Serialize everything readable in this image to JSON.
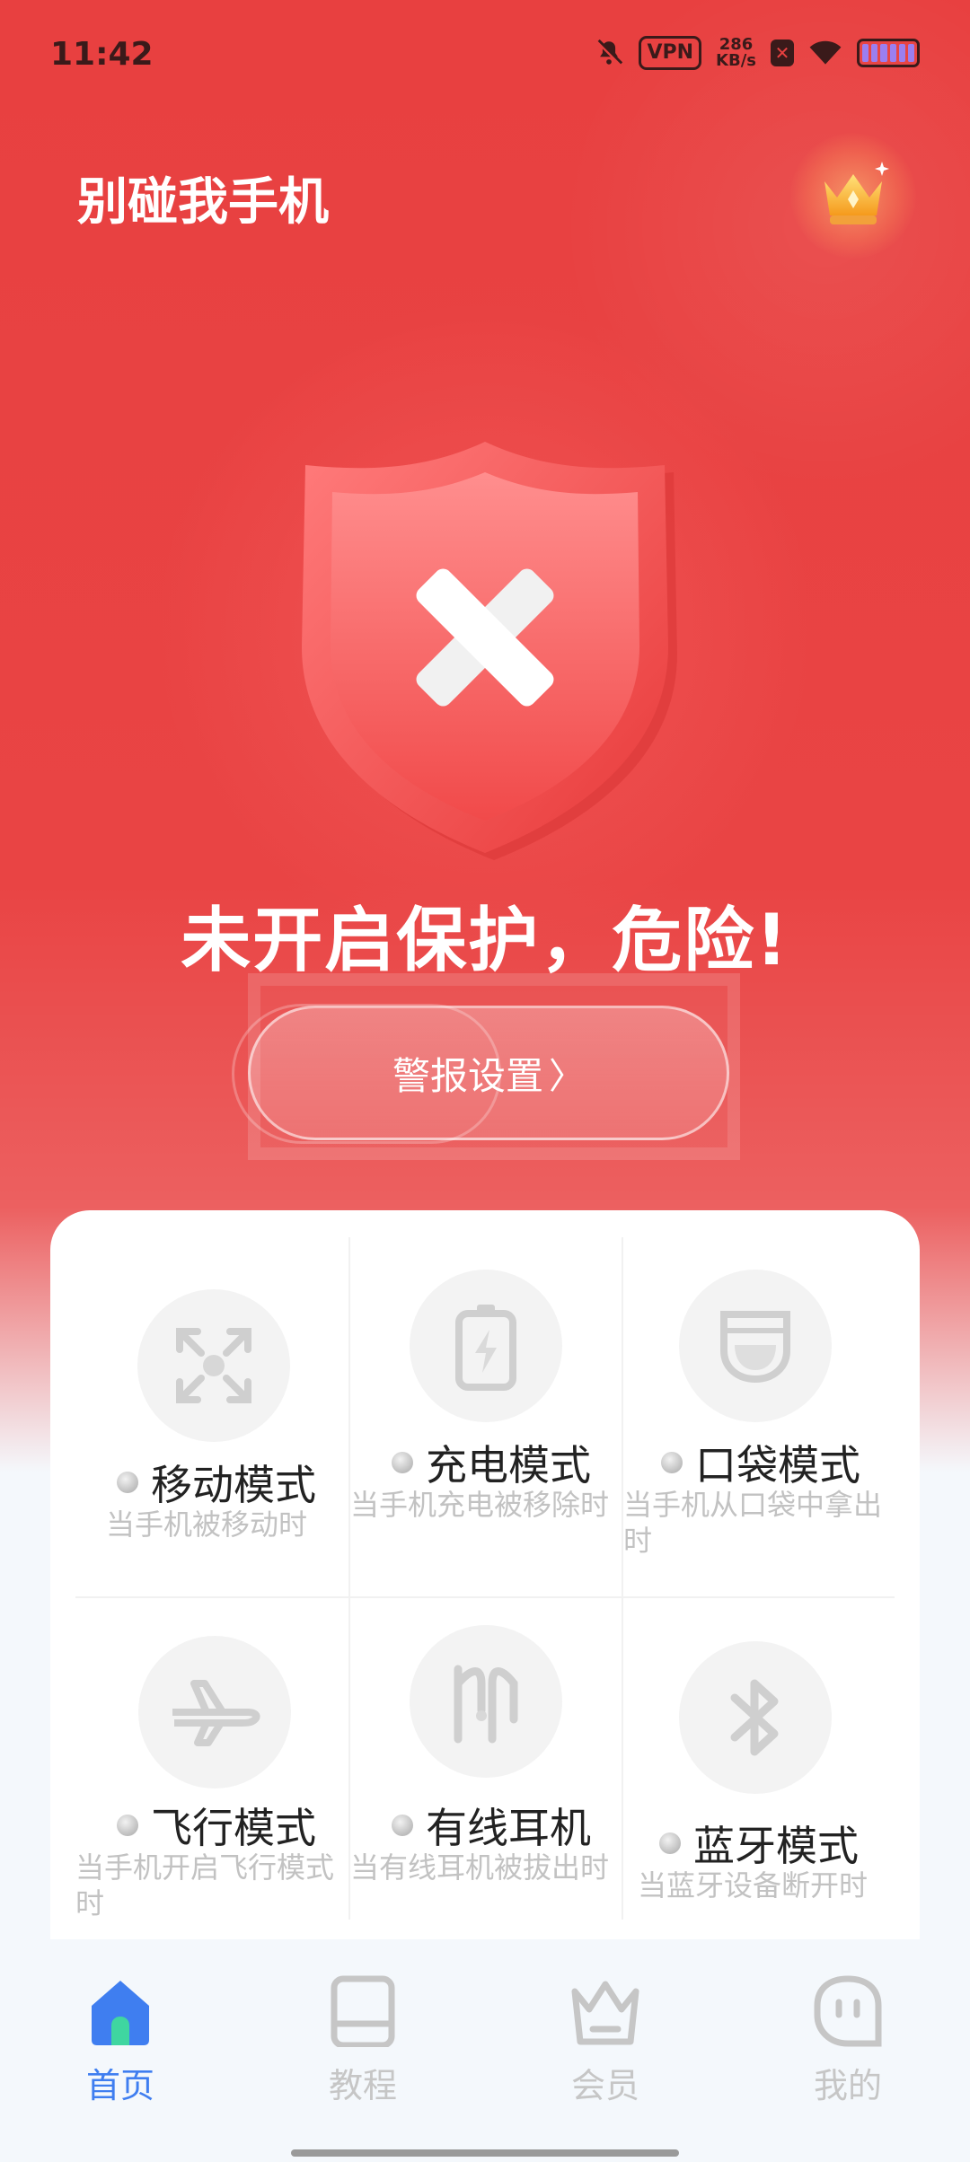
{
  "status_bar": {
    "time": "11:42",
    "vpn": "VPN",
    "speed_value": "286",
    "speed_unit": "KB/s"
  },
  "header": {
    "title": "别碰我手机",
    "vip_icon": "crown-icon"
  },
  "hero": {
    "shield_icon": "shield-x-icon",
    "status_text": "未开启保护，危险!",
    "alarm_button_label": "警报设置",
    "alarm_button_chevron": "〉"
  },
  "modes": [
    {
      "title": "移动模式",
      "desc": "当手机被移动时",
      "icon": "move-arrows-icon"
    },
    {
      "title": "充电模式",
      "desc": "当手机充电被移除时",
      "icon": "battery-icon"
    },
    {
      "title": "口袋模式",
      "desc": "当手机从口袋中拿出时",
      "icon": "pocket-icon"
    },
    {
      "title": "飞行模式",
      "desc": "当手机开启飞行模式时",
      "icon": "airplane-icon"
    },
    {
      "title": "有线耳机",
      "desc": "当有线耳机被拔出时",
      "icon": "wired-earphone-icon"
    },
    {
      "title": "蓝牙模式",
      "desc": "当蓝牙设备断开时",
      "icon": "bluetooth-icon"
    }
  ],
  "nav": {
    "items": [
      {
        "label": "首页",
        "icon": "home-icon",
        "active": true
      },
      {
        "label": "教程",
        "icon": "book-icon",
        "active": false
      },
      {
        "label": "会员",
        "icon": "crown-outline-icon",
        "active": false
      },
      {
        "label": "我的",
        "icon": "profile-face-icon",
        "active": false
      }
    ]
  },
  "colors": {
    "danger_red": "#e84040",
    "nav_active": "#3f7ef0",
    "nav_inactive": "#c6c6c6"
  }
}
